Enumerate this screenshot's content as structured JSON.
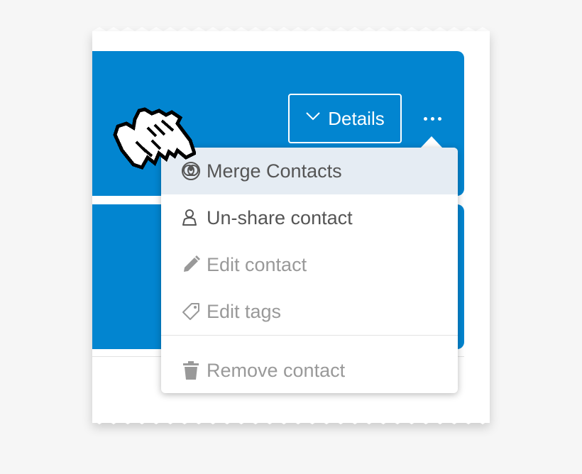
{
  "card": {
    "details_label": "Details"
  },
  "menu": {
    "items": [
      {
        "label": "Merge Contacts",
        "icon": "merge-contacts-icon",
        "state": "highlighted"
      },
      {
        "label": "Un-share contact",
        "icon": "person-outline-icon",
        "state": "enabled"
      },
      {
        "label": "Edit contact",
        "icon": "pencil-icon",
        "state": "disabled"
      },
      {
        "label": "Edit tags",
        "icon": "tag-icon",
        "state": "disabled"
      },
      {
        "label": "Remove contact",
        "icon": "trash-icon",
        "state": "disabled"
      }
    ]
  },
  "colors": {
    "accent": "#0285d0",
    "highlight": "#e5ecf3",
    "text": "#555555",
    "disabled_text": "#999999"
  }
}
